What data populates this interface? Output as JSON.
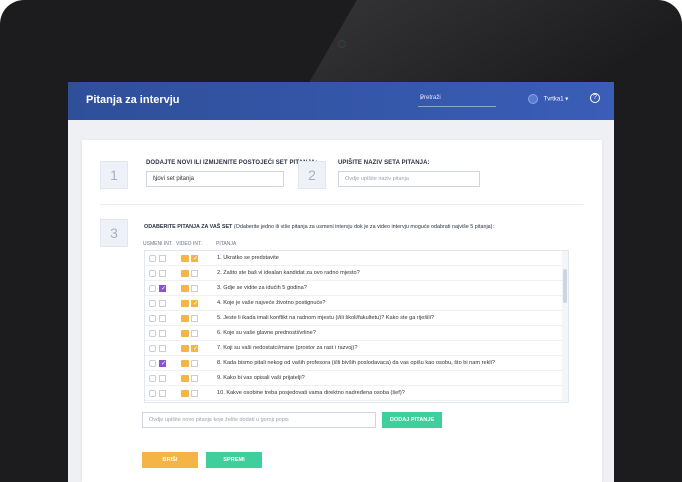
{
  "app": {
    "title": "Pitanja za intervju"
  },
  "search": {
    "placeholder": "Pretraži"
  },
  "user": {
    "name": "Tvrtka1"
  },
  "steps": {
    "one": "1",
    "two": "2",
    "three": "3"
  },
  "section1": {
    "label": "DODAJTE NOVI ILI IZMIJENITE POSTOJEĆI SET PITANJA:",
    "select_value": "Novi set pitanja"
  },
  "section2": {
    "label": "UPIŠITE NAZIV SETA PITANJA:",
    "input_placeholder": "Ovdje upišite naziv pitanja"
  },
  "section3": {
    "label": "ODABERITE PITANJA ZA VAŠ SET",
    "desc": " (Odaberite jedno ili više pitanja za usmeni intervju dok je za video intervju moguće odabrati najviše 5 pitanja):",
    "col_usmeni": "USMENI INT.",
    "col_video": "VIDEO INT.",
    "col_pitanja": "PITANJA"
  },
  "questions": [
    {
      "text": "1. Ukratko se predstavite",
      "usmeni": false,
      "video": true
    },
    {
      "text": "2. Zašto ste baš vi idealan kandidat za ovo radno mjesto?",
      "usmeni": false,
      "video": false
    },
    {
      "text": "3. Gdje se vidite za idućih 5 godina?",
      "usmeni": true,
      "video": false
    },
    {
      "text": "4. Koje je vaše najveće životno postignuće?",
      "usmeni": false,
      "video": true
    },
    {
      "text": "5. Jeste li ikada imali konflikt na radnom mjestu (i/ili školi/fakultetu)? Kako ste ga riješili?",
      "usmeni": false,
      "video": false
    },
    {
      "text": "6. Koje su vaše glavne prednosti/vrline?",
      "usmeni": false,
      "video": false
    },
    {
      "text": "7. Koji su vaši nedostatci/mane (prostor za rast i razvoj)?",
      "usmeni": false,
      "video": true
    },
    {
      "text": "8. Kada bismo pitali nekog od vaših profesora (i/ili bivših poslodavaca) da vas opišu kao osobu, što bi nam rekli?",
      "usmeni": true,
      "video": false
    },
    {
      "text": "9. Kako bi vas opisali vaši prijatelji?",
      "usmeni": false,
      "video": false
    },
    {
      "text": "10. Kakve osobine treba posjedovati vama direktno nadređena osoba (šef)?",
      "usmeni": false,
      "video": false
    }
  ],
  "new_question": {
    "placeholder": "Ovdje upišite novo pitanje koje želite dodati u gornji popis"
  },
  "buttons": {
    "add": "DODAJ PITANJE",
    "delete": "BRIŠI",
    "save": "SPREMI"
  }
}
